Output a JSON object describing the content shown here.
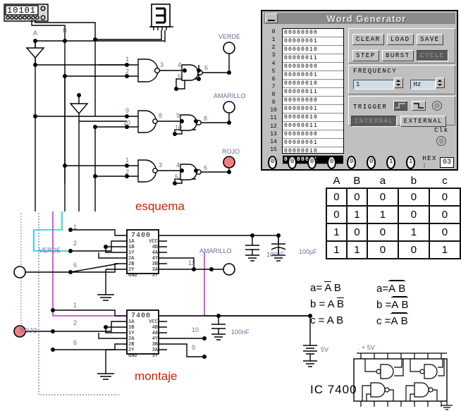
{
  "word_generator": {
    "title": "Word Generator",
    "minimize_icon": "minimize-icon",
    "rows": [
      {
        "index": "0",
        "word": "00000000",
        "selected": false
      },
      {
        "index": "1",
        "word": "00000001",
        "selected": false
      },
      {
        "index": "2",
        "word": "00000010",
        "selected": false
      },
      {
        "index": "3",
        "word": "00000011",
        "selected": false
      },
      {
        "index": "4",
        "word": "00000000",
        "selected": false
      },
      {
        "index": "5",
        "word": "00000001",
        "selected": false
      },
      {
        "index": "6",
        "word": "00000010",
        "selected": false
      },
      {
        "index": "7",
        "word": "00000011",
        "selected": false
      },
      {
        "index": "8",
        "word": "00000000",
        "selected": false
      },
      {
        "index": "9",
        "word": "00000001",
        "selected": false
      },
      {
        "index": "10",
        "word": "00000010",
        "selected": false
      },
      {
        "index": "11",
        "word": "00000011",
        "selected": false
      },
      {
        "index": "12",
        "word": "00000000",
        "selected": false
      },
      {
        "index": "13",
        "word": "00000001",
        "selected": false
      },
      {
        "index": "14",
        "word": "00000010",
        "selected": false
      },
      {
        "index": "15",
        "word": "00000011",
        "selected": true
      }
    ],
    "buttons": {
      "clear": "CLEAR",
      "load": "LOAD",
      "save": "SAVE",
      "step": "STEP",
      "burst": "BURST",
      "cycle": "CYCLE",
      "cycle_active": true
    },
    "frequency": {
      "label": "FREQUENCY",
      "value": "1",
      "unit": "Hz"
    },
    "trigger": {
      "label": "TRIGGER",
      "internal": "INTERNAL",
      "external": "EXTERNAL",
      "internal_active": true,
      "clk_label": "Clk"
    },
    "output_bits": [
      "0",
      "0",
      "0",
      "0",
      "0",
      "0",
      "1",
      "1"
    ],
    "hex_label": "HEX :",
    "hex_value": "03"
  },
  "truth_table": {
    "headers": [
      "A",
      "B",
      "a",
      "b",
      "c"
    ],
    "rows": [
      [
        "0",
        "0",
        "0",
        "0",
        "0"
      ],
      [
        "0",
        "1",
        "1",
        "0",
        "0"
      ],
      [
        "1",
        "0",
        "0",
        "1",
        "0"
      ],
      [
        "1",
        "1",
        "0",
        "0",
        "1"
      ]
    ]
  },
  "equations": {
    "left": [
      {
        "out": "a=",
        "t1": "A",
        "t1bar": true,
        "t2": "B",
        "t2bar": false
      },
      {
        "out": "b =",
        "t1": "A",
        "t1bar": false,
        "t2": "B",
        "t2bar": true
      },
      {
        "out": "c =",
        "t1": "A",
        "t1bar": false,
        "t2": "B",
        "t2bar": false
      }
    ],
    "right": [
      {
        "out": "a=",
        "t1": "A",
        "t2": "B",
        "double": true
      },
      {
        "out": "b =",
        "t1": "A",
        "t2": "B",
        "double": true
      },
      {
        "out": "c =",
        "t1": "A",
        "t2": "B",
        "double": true
      }
    ]
  },
  "schematic": {
    "caption": "esquema",
    "display_value": "10101",
    "seven_segment_value": "3",
    "input_labels": {
      "a": "A",
      "b": "B"
    },
    "lamps": [
      {
        "name": "VERDE",
        "pin": "6",
        "on": false
      },
      {
        "name": "AMARILLO",
        "pin": "8",
        "on": false
      },
      {
        "name": "ROJO",
        "pin": "6",
        "on": true
      }
    ],
    "gate_pins_row1": [
      "1",
      "2",
      "3",
      "4",
      "5",
      "6"
    ],
    "gate_pins_row2": [
      "9",
      "10",
      "8",
      "9",
      "10",
      "8"
    ],
    "gate_pins_row3": [
      "1",
      "2",
      "3",
      "4",
      "5",
      "6"
    ]
  },
  "montage": {
    "caption": "montaje",
    "ic_top": {
      "part": "7400",
      "left_pins": [
        "1A",
        "1B",
        "1Y",
        "2A",
        "2B",
        "2Y",
        "GND"
      ],
      "right_pins": [
        "VCC",
        "4B",
        "4A",
        "4Y",
        "3B",
        "3A",
        "3Y"
      ]
    },
    "ic_bottom": {
      "part": "7400",
      "left_pins": [
        "1A",
        "1B",
        "1Y",
        "2A",
        "2B",
        "2Y",
        "GND"
      ],
      "right_pins": [
        "VCC",
        "4B",
        "4A",
        "4Y",
        "3B",
        "3A",
        "3Y"
      ]
    },
    "lamps": [
      {
        "name": "VERDE",
        "pin_in_1": "1",
        "pin_in_2": "2",
        "pin_out": "6"
      },
      {
        "name": "AMARILLO",
        "pin": "11"
      },
      {
        "name": "ROJO",
        "pin_in_1": "1",
        "pin_in_2": "2",
        "pin_out": "6"
      }
    ],
    "pin_10": "10",
    "pin_9": "9",
    "capacitors": [
      {
        "value": "100nF"
      },
      {
        "value": "100µF"
      },
      {
        "value": "100nF"
      }
    ],
    "battery": "5V"
  },
  "ic_diagram": {
    "title": "IC 7400",
    "supply": ". + 5V"
  },
  "colors": {
    "window_face": "#c0c0c0",
    "titlebar": "#8a8a8a",
    "lamp_on": "#f08080",
    "caption_red": "#cc2200",
    "label_blue": "#6a6a9a",
    "wire_magenta": "#cc33cc",
    "wire_cyan": "#00d0e0",
    "wire_blue_dot": "#7a7ac0",
    "wire_salmon_dot": "#d09080"
  }
}
